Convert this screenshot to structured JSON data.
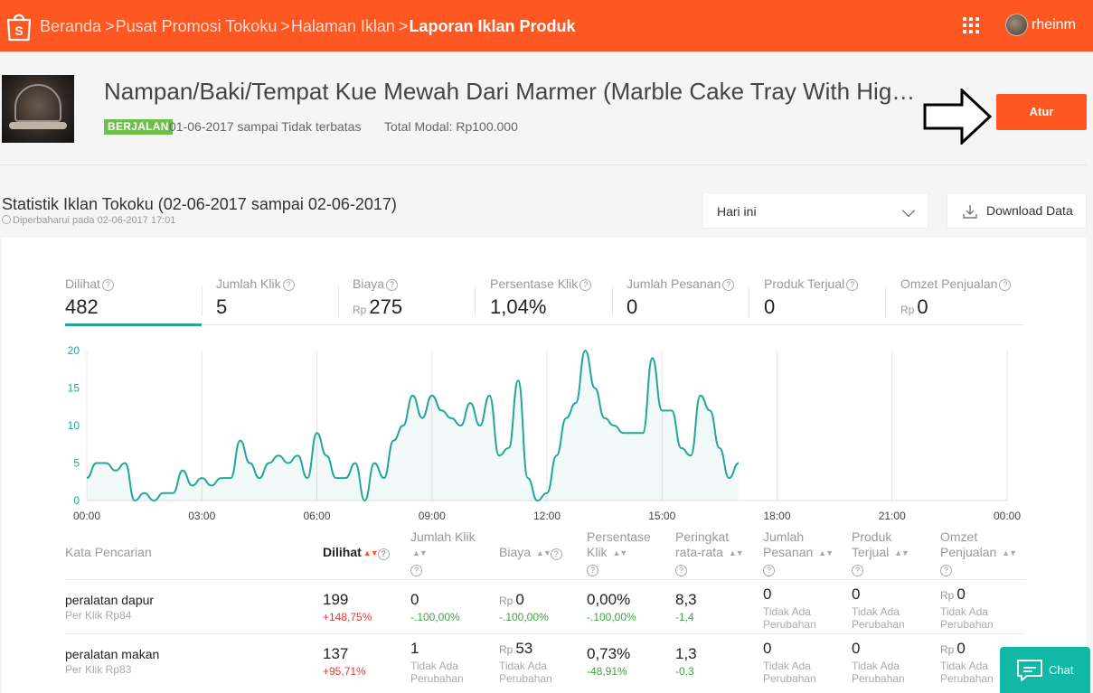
{
  "header": {
    "breadcrumbs": [
      "Beranda",
      "Pusat Promosi Tokoku",
      "Halaman Iklan"
    ],
    "current_page": "Laporan Iklan Produk",
    "separator": ">",
    "username": "rheinm",
    "brand_color": "#ff5722"
  },
  "product": {
    "title": "Nampan/Baki/Tempat Kue Mewah Dari Marmer (Marble Cake Tray With High Dome Glass)",
    "status": "BERJALAN",
    "date_range": "01-06-2017 sampai Tidak terbatas",
    "budget": "Total Modal: Rp100.000",
    "edit_button": "Atur"
  },
  "stats": {
    "title": "Statistik Iklan Tokoku (02-06-2017 sampai 02-06-2017)",
    "updated": "Diperbaharui pada 02-06-2017 17:01",
    "period": "Hari ini",
    "download": "Download Data",
    "metrics": [
      {
        "label": "Dilihat",
        "value": "482",
        "currency": ""
      },
      {
        "label": "Jumlah Klik",
        "value": "5",
        "currency": ""
      },
      {
        "label": "Biaya",
        "value": "275",
        "currency": "Rp"
      },
      {
        "label": "Persentase Klik",
        "value": "1,04%",
        "currency": ""
      },
      {
        "label": "Jumlah Pesanan",
        "value": "0",
        "currency": ""
      },
      {
        "label": "Produk Terjual",
        "value": "0",
        "currency": ""
      },
      {
        "label": "Omzet Penjualan",
        "value": "0",
        "currency": "Rp"
      }
    ]
  },
  "chart_data": {
    "type": "area",
    "title": "",
    "xlabel": "",
    "ylabel": "",
    "x_ticks": [
      "00:00",
      "03:00",
      "06:00",
      "09:00",
      "12:00",
      "15:00",
      "18:00",
      "21:00",
      "00:00"
    ],
    "y_ticks": [
      "0",
      "5",
      "10",
      "15",
      "20"
    ],
    "xlim": [
      0,
      24
    ],
    "ylim": [
      0,
      20
    ],
    "grid": true,
    "line_color": "#26a69a",
    "series": [
      {
        "x": [
          0,
          0.25,
          0.5,
          0.75,
          1.0,
          1.25,
          1.5,
          1.75,
          2.0,
          2.25,
          2.5,
          2.75,
          3.0,
          3.25,
          3.5,
          3.75,
          4.0,
          4.25,
          4.5,
          4.75,
          5.0,
          5.25,
          5.5,
          5.75,
          6.0,
          6.25,
          6.5,
          6.75,
          7.0,
          7.25,
          7.5,
          7.75,
          8.0,
          8.25,
          8.5,
          8.75,
          9.0,
          9.25,
          9.5,
          9.75,
          10.0,
          10.25,
          10.5,
          10.75,
          11.0,
          11.25,
          11.5,
          11.75,
          12.0,
          12.25,
          12.5,
          12.75,
          13.0,
          13.25,
          13.5,
          13.75,
          14.0,
          14.25,
          14.5,
          14.75,
          15.0,
          15.25,
          15.5,
          15.75,
          16.0,
          16.25,
          16.5,
          16.75,
          17.0
        ],
        "values": [
          3,
          5,
          5,
          4,
          5,
          0,
          1,
          0,
          1,
          1,
          4,
          2,
          3,
          2,
          3,
          3,
          8,
          5,
          3,
          5,
          6,
          5,
          6,
          3,
          9,
          6,
          3,
          3,
          5,
          0,
          5,
          3,
          8,
          10,
          14,
          11,
          14,
          12,
          11,
          10,
          13,
          10,
          14,
          6,
          7,
          16,
          3,
          0,
          1,
          6,
          11,
          13,
          20,
          15,
          11,
          10,
          9,
          9,
          9,
          19,
          12,
          12,
          7,
          6,
          14,
          12,
          7,
          3,
          5
        ]
      }
    ]
  },
  "table": {
    "headers": {
      "keyword": "Kata Pencarian",
      "views": "Dilihat",
      "clicks": [
        "Jumlah Klik"
      ],
      "cost": "Biaya",
      "ctr": [
        "Persentase",
        "Klik"
      ],
      "rank": [
        "Peringkat",
        "rata-rata"
      ],
      "orders": [
        "Jumlah",
        "Pesanan"
      ],
      "sold": [
        "Produk",
        "Terjual"
      ],
      "revenue": [
        "Omzet",
        "Penjualan"
      ]
    },
    "currency": "Rp",
    "rows": [
      {
        "keyword": "peralatan dapur",
        "cpc": "Per Klik Rp84",
        "views": "199",
        "views_change": "+148,75%",
        "clicks": "0",
        "clicks_change": "-.100,00%",
        "cost": "0",
        "cost_change": "-.100,00%",
        "ctr": "0,00%",
        "ctr_change": "-.100,00%",
        "rank": "8,3",
        "rank_change": "-1,4",
        "orders": "0",
        "orders_change": "Tidak Ada Perubahan",
        "sold": "0",
        "sold_change": "Tidak Ada Perubahan",
        "revenue": "0",
        "revenue_change": "Tidak Ada Perubahan"
      },
      {
        "keyword": "peralatan makan",
        "cpc": "Per Klik Rp83",
        "views": "137",
        "views_change": "+95,71%",
        "clicks": "1",
        "clicks_change": "Tidak Ada Perubahan",
        "cost": "53",
        "cost_change": "Tidak Ada Perubahan",
        "ctr": "0,73%",
        "ctr_change": "-48,91%",
        "rank": "1,3",
        "rank_change": "-0,3",
        "orders": "0",
        "orders_change": "Tidak Ada Perubahan",
        "sold": "0",
        "sold_change": "Tidak Ada Perubahan",
        "revenue": "0",
        "revenue_change": "Tidak Ada Perubahan"
      }
    ]
  },
  "chat": {
    "label": "Chat"
  }
}
